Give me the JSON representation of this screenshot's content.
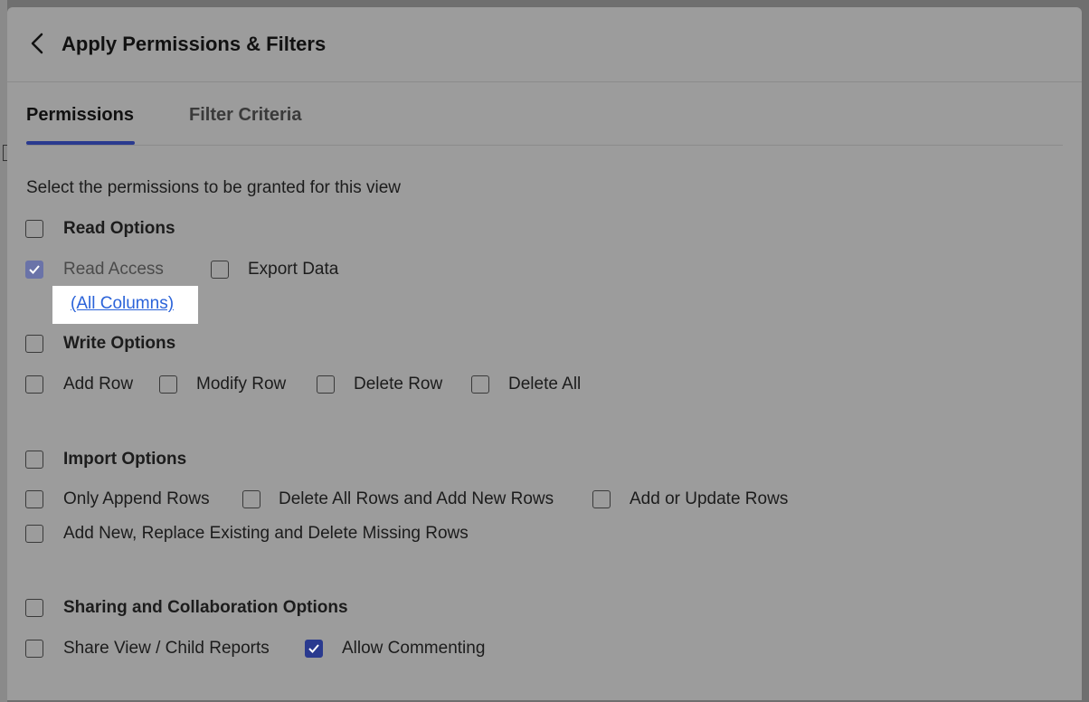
{
  "dialog": {
    "title": "Apply Permissions & Filters",
    "back_icon": "chevron-left-icon"
  },
  "tabs": [
    {
      "label": "Permissions",
      "active": true
    },
    {
      "label": "Filter Criteria",
      "active": false
    }
  ],
  "intro_text": "Select the permissions to be granted for this view",
  "read": {
    "group_label": "Read Options",
    "group_checked": false,
    "read_access": {
      "label": "Read Access",
      "checked": true,
      "disabled": true
    },
    "export_data": {
      "label": "Export Data",
      "checked": false
    },
    "columns_link": "(All Columns)"
  },
  "write": {
    "group_label": "Write Options",
    "group_checked": false,
    "options": [
      {
        "label": "Add Row",
        "checked": false
      },
      {
        "label": "Modify Row",
        "checked": false
      },
      {
        "label": "Delete Row",
        "checked": false
      },
      {
        "label": "Delete All",
        "checked": false
      }
    ]
  },
  "import": {
    "group_label": "Import Options",
    "group_checked": false,
    "options": [
      {
        "label": "Only Append Rows",
        "checked": false
      },
      {
        "label": "Delete All Rows and Add New Rows",
        "checked": false
      },
      {
        "label": "Add or Update Rows",
        "checked": false
      },
      {
        "label": "Add New, Replace Existing and Delete Missing Rows",
        "checked": false
      }
    ]
  },
  "sharing": {
    "group_label": "Sharing and Collaboration Options",
    "group_checked": false,
    "options": [
      {
        "label": "Share View / Child Reports",
        "checked": false
      },
      {
        "label": "Allow Commenting",
        "checked": true
      }
    ]
  },
  "colors": {
    "accent": "#2a3a8f",
    "link": "#2b63d9"
  }
}
